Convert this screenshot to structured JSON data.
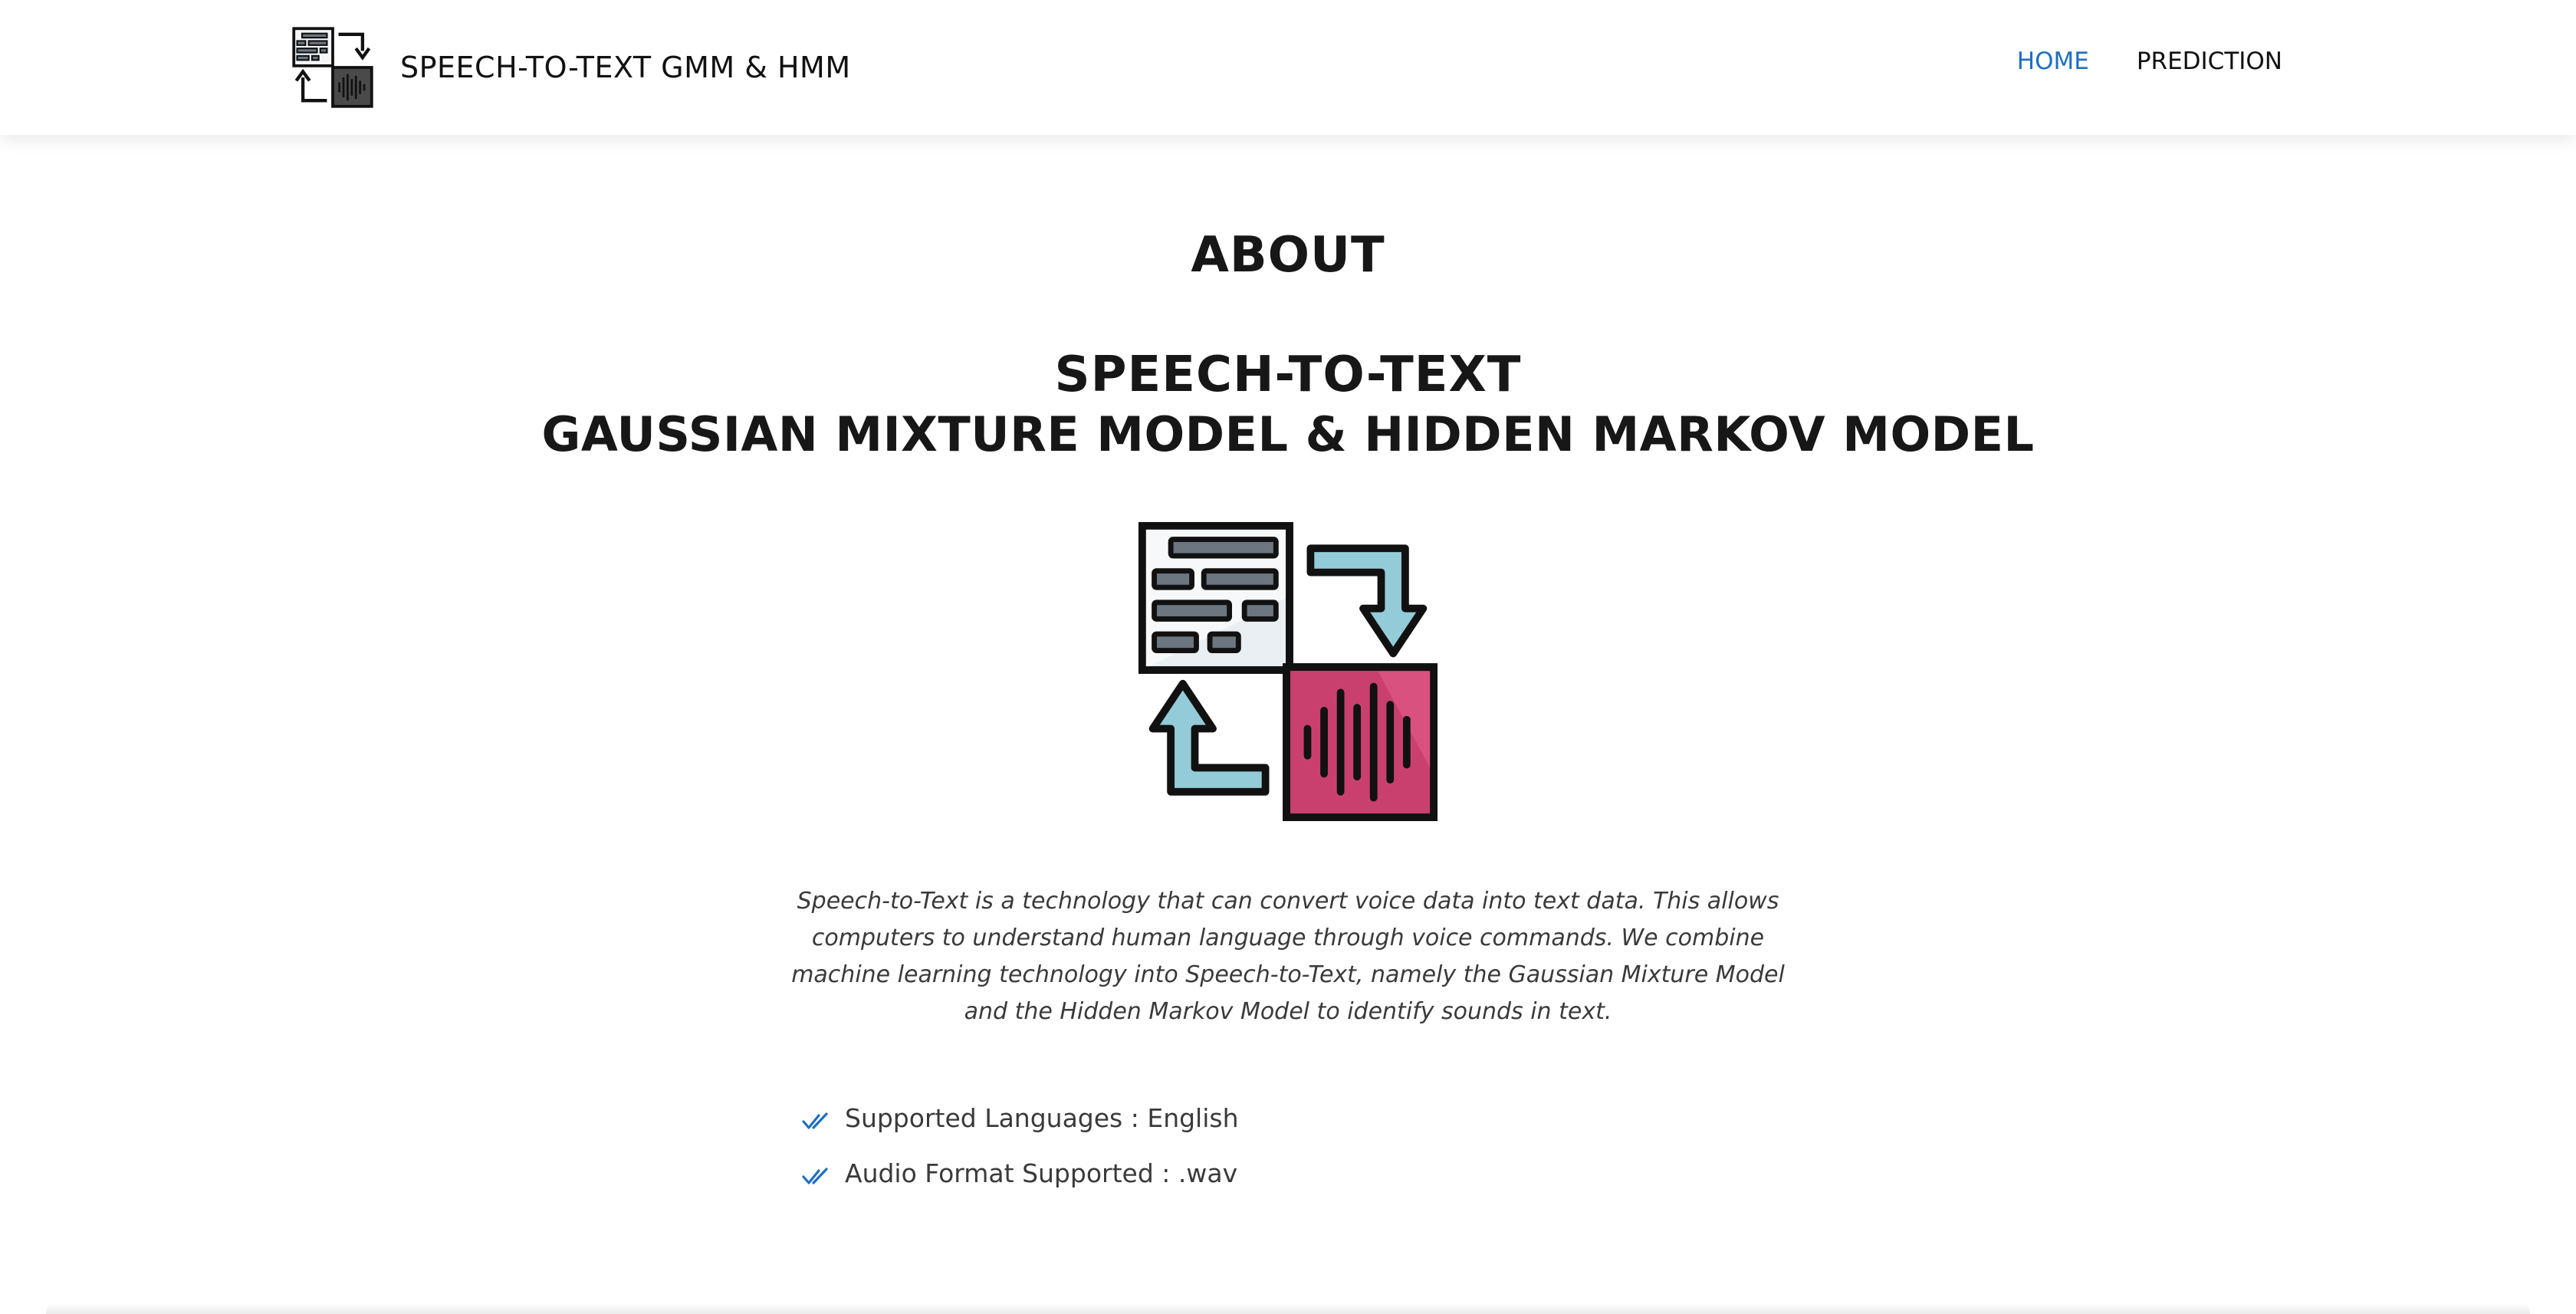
{
  "header": {
    "brand_title": "SPEECH-TO-TEXT GMM & HMM",
    "brand_logo_icon": "speech-to-text-logo-icon",
    "nav": [
      {
        "label": "HOME",
        "active": true
      },
      {
        "label": "PREDICTION",
        "active": false
      }
    ]
  },
  "main": {
    "heading": "ABOUT",
    "subtitle_line1": "SPEECH-TO-TEXT",
    "subtitle_line2": "GAUSSIAN MIXTURE MODEL & HIDDEN MARKOV MODEL",
    "illustration_icon": "speech-to-text-illustration-icon",
    "description": "Speech-to-Text is a technology that can convert voice data into text data. This allows computers to understand human language through voice commands. We combine machine learning technology into Speech-to-Text, namely the Gaussian Mixture Model and the Hidden Markov Model to identify sounds in text.",
    "features": [
      {
        "icon": "double-check-icon",
        "text": "Supported Languages : English"
      },
      {
        "icon": "double-check-icon",
        "text": "Audio Format Supported : .wav"
      }
    ]
  },
  "colors": {
    "accent": "#1e6fc0",
    "text": "#1b1b1b",
    "muted_text": "#3a3a3a",
    "illustration_pink": "#c9406f",
    "illustration_blue": "#93cbd9",
    "illustration_gray": "#6b7680"
  }
}
